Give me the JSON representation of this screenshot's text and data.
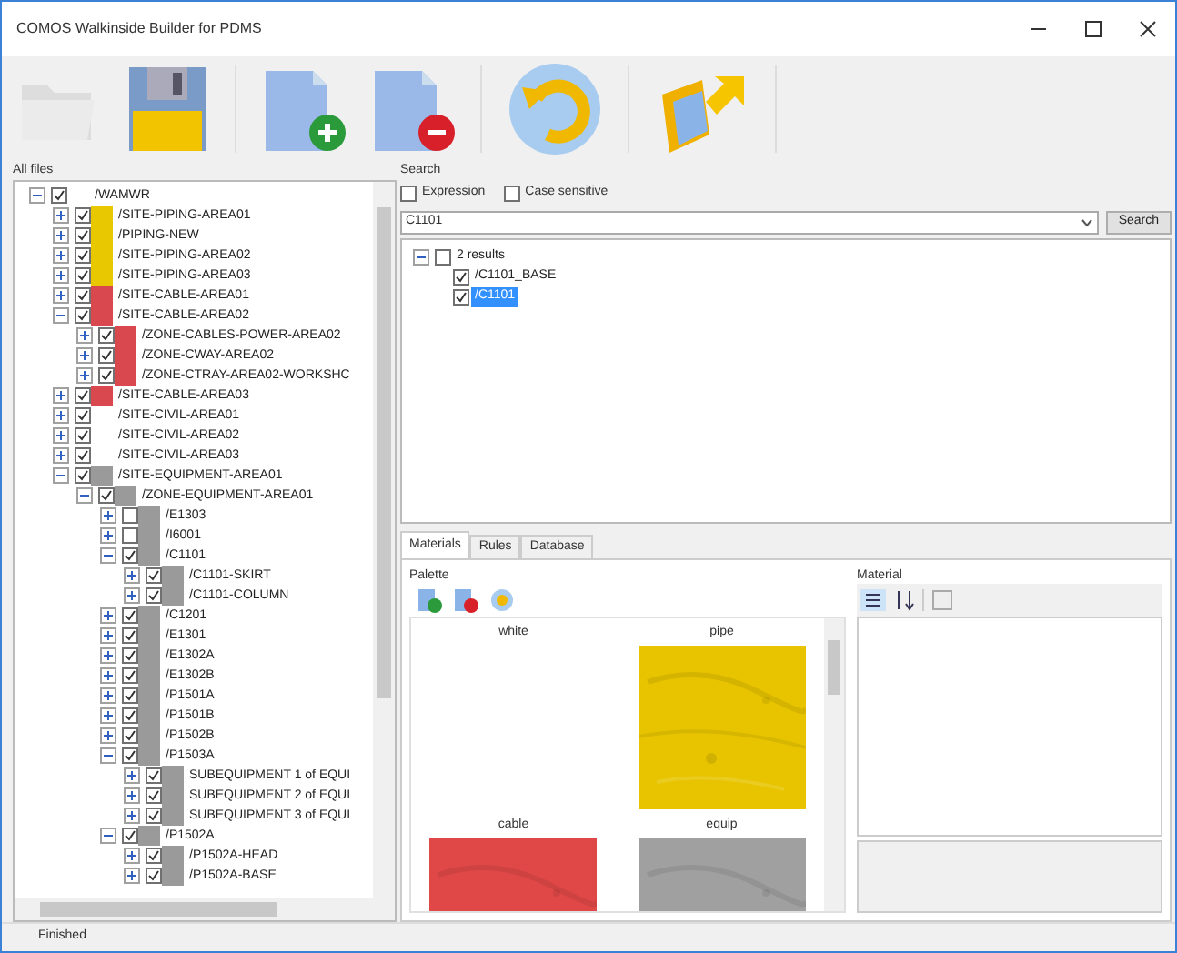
{
  "window": {
    "title": "COMOS Walkinside Builder for PDMS"
  },
  "all_files": {
    "label": "All files",
    "tree": [
      {
        "label": "/WAMWR",
        "checked": true,
        "expanded": true,
        "children": [
          {
            "label": "/SITE-PIPING-AREA01",
            "checked": true,
            "expanded": false,
            "color": "#e8c800"
          },
          {
            "label": "/PIPING-NEW",
            "checked": true,
            "expanded": false,
            "color": "#e8c800"
          },
          {
            "label": "/SITE-PIPING-AREA02",
            "checked": true,
            "expanded": false,
            "color": "#e8c800"
          },
          {
            "label": "/SITE-PIPING-AREA03",
            "checked": true,
            "expanded": false,
            "color": "#e8c800"
          },
          {
            "label": "/SITE-CABLE-AREA01",
            "checked": true,
            "expanded": false,
            "color": "#d9484e"
          },
          {
            "label": "/SITE-CABLE-AREA02",
            "checked": true,
            "expanded": true,
            "color": "#d9484e",
            "children": [
              {
                "label": "/ZONE-CABLES-POWER-AREA02",
                "checked": true,
                "expanded": false,
                "color": "#d9484e"
              },
              {
                "label": "/ZONE-CWAY-AREA02",
                "checked": true,
                "expanded": false,
                "color": "#d9484e"
              },
              {
                "label": "/ZONE-CTRAY-AREA02-WORKSHC",
                "checked": true,
                "expanded": false,
                "color": "#d9484e"
              }
            ]
          },
          {
            "label": "/SITE-CABLE-AREA03",
            "checked": true,
            "expanded": false,
            "color": "#d9484e"
          },
          {
            "label": "/SITE-CIVIL-AREA01",
            "checked": true,
            "expanded": false
          },
          {
            "label": "/SITE-CIVIL-AREA02",
            "checked": true,
            "expanded": false
          },
          {
            "label": "/SITE-CIVIL-AREA03",
            "checked": true,
            "expanded": false
          },
          {
            "label": "/SITE-EQUIPMENT-AREA01",
            "checked": true,
            "expanded": true,
            "color": "#9a9a9a",
            "children": [
              {
                "label": "/ZONE-EQUIPMENT-AREA01",
                "checked": true,
                "expanded": true,
                "color": "#9a9a9a",
                "children": [
                  {
                    "label": "/E1303",
                    "checked": false,
                    "expanded": false,
                    "color": "#9a9a9a"
                  },
                  {
                    "label": "/I6001",
                    "checked": false,
                    "expanded": false,
                    "color": "#9a9a9a"
                  },
                  {
                    "label": "/C1101",
                    "checked": true,
                    "expanded": true,
                    "color": "#9a9a9a",
                    "children": [
                      {
                        "label": "/C1101-SKIRT",
                        "checked": true,
                        "expanded": false,
                        "color": "#9a9a9a"
                      },
                      {
                        "label": "/C1101-COLUMN",
                        "checked": true,
                        "expanded": false,
                        "color": "#9a9a9a"
                      }
                    ]
                  },
                  {
                    "label": "/C1201",
                    "checked": true,
                    "expanded": false,
                    "color": "#9a9a9a"
                  },
                  {
                    "label": "/E1301",
                    "checked": true,
                    "expanded": false,
                    "color": "#9a9a9a"
                  },
                  {
                    "label": "/E1302A",
                    "checked": true,
                    "expanded": false,
                    "color": "#9a9a9a"
                  },
                  {
                    "label": "/E1302B",
                    "checked": true,
                    "expanded": false,
                    "color": "#9a9a9a"
                  },
                  {
                    "label": "/P1501A",
                    "checked": true,
                    "expanded": false,
                    "color": "#9a9a9a"
                  },
                  {
                    "label": "/P1501B",
                    "checked": true,
                    "expanded": false,
                    "color": "#9a9a9a"
                  },
                  {
                    "label": "/P1502B",
                    "checked": true,
                    "expanded": false,
                    "color": "#9a9a9a"
                  },
                  {
                    "label": "/P1503A",
                    "checked": true,
                    "expanded": true,
                    "color": "#9a9a9a",
                    "children": [
                      {
                        "label": "SUBEQUIPMENT 1 of EQUI",
                        "checked": true,
                        "expanded": false,
                        "color": "#9a9a9a"
                      },
                      {
                        "label": "SUBEQUIPMENT 2 of EQUI",
                        "checked": true,
                        "expanded": false,
                        "color": "#9a9a9a"
                      },
                      {
                        "label": "SUBEQUIPMENT 3 of EQUI",
                        "checked": true,
                        "expanded": false,
                        "color": "#9a9a9a"
                      }
                    ]
                  },
                  {
                    "label": "/P1502A",
                    "checked": true,
                    "expanded": true,
                    "color": "#9a9a9a",
                    "children": [
                      {
                        "label": "/P1502A-HEAD",
                        "checked": true,
                        "expanded": false,
                        "color": "#9a9a9a"
                      },
                      {
                        "label": "/P1502A-BASE",
                        "checked": true,
                        "expanded": false,
                        "color": "#9a9a9a"
                      }
                    ]
                  }
                ]
              }
            ]
          }
        ]
      }
    ]
  },
  "search": {
    "label": "Search",
    "options": [
      {
        "label": "Expression",
        "checked": false
      },
      {
        "label": "Case sensitive",
        "checked": false
      }
    ],
    "value": "C1101",
    "button": "Search",
    "results": {
      "label": "2 results",
      "checked": false,
      "expanded": true,
      "children": [
        {
          "label": "/C1101_BASE",
          "checked": true,
          "selected": false
        },
        {
          "label": "/C1101",
          "checked": true,
          "selected": true
        }
      ]
    }
  },
  "tabs": [
    {
      "label": "Materials",
      "selected": true
    },
    {
      "label": "Rules",
      "selected": false
    },
    {
      "label": "Database",
      "selected": false
    }
  ],
  "palette": {
    "label": "Palette",
    "materials": [
      {
        "name": "white"
      },
      {
        "name": "pipe",
        "color": "#e8c400"
      },
      {
        "name": "cable",
        "color": "#e04848"
      },
      {
        "name": "equip",
        "color": "#a0a0a0"
      }
    ]
  },
  "material": {
    "label": "Material"
  },
  "status_bar": "Finished"
}
